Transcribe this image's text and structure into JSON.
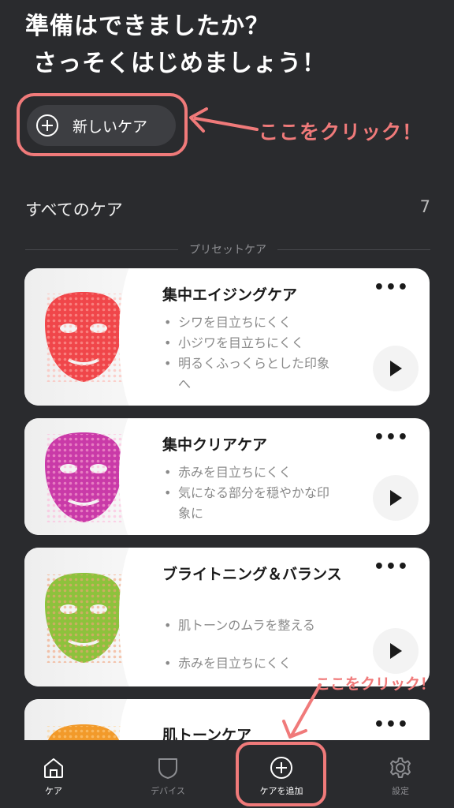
{
  "header": {
    "line1": "準備はできましたか？",
    "line2": "さっそくはじめましょう！"
  },
  "new_care_button": {
    "label": "新しいケア"
  },
  "annotations": {
    "top": "ここをクリック！",
    "bottom": "ここをクリック！",
    "highlight_color": "#f07a7a"
  },
  "all_care": {
    "label": "すべてのケア",
    "count": "7"
  },
  "section": {
    "label": "プリセットケア"
  },
  "cards": [
    {
      "title": "集中エイジングケア",
      "mask_color": "#f0464a",
      "bullets": [
        "シワを目立ちにくく",
        "小ジワを目立ちにくく",
        "明るくふっくらとした印象へ"
      ]
    },
    {
      "title": "集中クリアケア",
      "mask_color": "#c93aa8",
      "bullets": [
        "赤みを目立ちにくく",
        "気になる部分を穏やかな印象に"
      ]
    },
    {
      "title": "ブライトニング＆バランス",
      "mask_color": "#8dc23c",
      "bullets": [
        "肌トーンのムラを整える",
        "赤みを目立ちにくく"
      ]
    },
    {
      "title": "肌トーンケア",
      "mask_color": "#f29a2a",
      "bullets": []
    }
  ],
  "tabbar": {
    "items": [
      {
        "label": "ケア",
        "icon": "home-icon"
      },
      {
        "label": "デバイス",
        "icon": "shield-icon"
      },
      {
        "label": "ケアを追加",
        "icon": "plus-circle-icon"
      },
      {
        "label": "設定",
        "icon": "gear-icon"
      }
    ]
  }
}
